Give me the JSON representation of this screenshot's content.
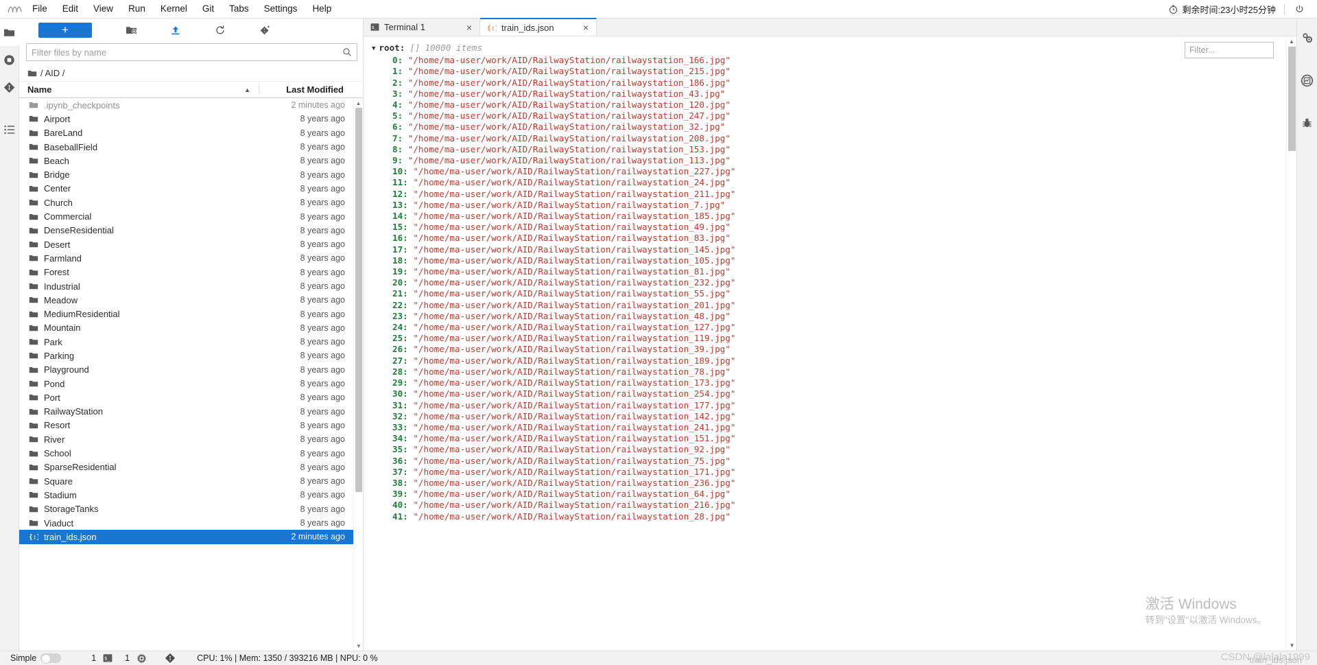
{
  "menubar": {
    "logo_name": "jupyter-logo",
    "items": [
      "File",
      "Edit",
      "View",
      "Run",
      "Kernel",
      "Git",
      "Tabs",
      "Settings",
      "Help"
    ],
    "timer_text": "剩余时间:23小时25分钟",
    "power_label": "power-icon"
  },
  "left_activity": [
    {
      "name": "sidebar-item-file-browser",
      "icon": "folder-icon"
    },
    {
      "name": "sidebar-item-running-sessions",
      "icon": "stop-circle-icon"
    },
    {
      "name": "sidebar-item-git",
      "icon": "git-icon"
    },
    {
      "name": "sidebar-item-table-of-contents",
      "icon": "list-icon"
    }
  ],
  "right_activity": [
    {
      "name": "sidebar-item-property-inspector",
      "icon": "gears-icon"
    },
    {
      "name": "sidebar-item-extension-manager",
      "icon": "chart-circle-icon"
    },
    {
      "name": "sidebar-item-debugger",
      "icon": "bug-icon"
    }
  ],
  "filebrowser": {
    "toolbar": {
      "new_launcher_label": "+",
      "new_folder_label": "new-folder-icon",
      "upload_label": "upload-icon",
      "refresh_label": "refresh-icon",
      "git_clone_label": "git-clone-icon"
    },
    "filter_placeholder": "Filter files by name",
    "filter_value": "",
    "breadcrumb": "/ AID /",
    "columns": {
      "name": "Name",
      "last_modified": "Last Modified"
    },
    "rows": [
      {
        "name": ".ipynb_checkpoints",
        "modified": "2 minutes ago",
        "type": "folder",
        "dim": true,
        "selected": false
      },
      {
        "name": "Airport",
        "modified": "8 years ago",
        "type": "folder",
        "dim": false,
        "selected": false
      },
      {
        "name": "BareLand",
        "modified": "8 years ago",
        "type": "folder",
        "dim": false,
        "selected": false
      },
      {
        "name": "BaseballField",
        "modified": "8 years ago",
        "type": "folder",
        "dim": false,
        "selected": false
      },
      {
        "name": "Beach",
        "modified": "8 years ago",
        "type": "folder",
        "dim": false,
        "selected": false
      },
      {
        "name": "Bridge",
        "modified": "8 years ago",
        "type": "folder",
        "dim": false,
        "selected": false
      },
      {
        "name": "Center",
        "modified": "8 years ago",
        "type": "folder",
        "dim": false,
        "selected": false
      },
      {
        "name": "Church",
        "modified": "8 years ago",
        "type": "folder",
        "dim": false,
        "selected": false
      },
      {
        "name": "Commercial",
        "modified": "8 years ago",
        "type": "folder",
        "dim": false,
        "selected": false
      },
      {
        "name": "DenseResidential",
        "modified": "8 years ago",
        "type": "folder",
        "dim": false,
        "selected": false
      },
      {
        "name": "Desert",
        "modified": "8 years ago",
        "type": "folder",
        "dim": false,
        "selected": false
      },
      {
        "name": "Farmland",
        "modified": "8 years ago",
        "type": "folder",
        "dim": false,
        "selected": false
      },
      {
        "name": "Forest",
        "modified": "8 years ago",
        "type": "folder",
        "dim": false,
        "selected": false
      },
      {
        "name": "Industrial",
        "modified": "8 years ago",
        "type": "folder",
        "dim": false,
        "selected": false
      },
      {
        "name": "Meadow",
        "modified": "8 years ago",
        "type": "folder",
        "dim": false,
        "selected": false
      },
      {
        "name": "MediumResidential",
        "modified": "8 years ago",
        "type": "folder",
        "dim": false,
        "selected": false
      },
      {
        "name": "Mountain",
        "modified": "8 years ago",
        "type": "folder",
        "dim": false,
        "selected": false
      },
      {
        "name": "Park",
        "modified": "8 years ago",
        "type": "folder",
        "dim": false,
        "selected": false
      },
      {
        "name": "Parking",
        "modified": "8 years ago",
        "type": "folder",
        "dim": false,
        "selected": false
      },
      {
        "name": "Playground",
        "modified": "8 years ago",
        "type": "folder",
        "dim": false,
        "selected": false
      },
      {
        "name": "Pond",
        "modified": "8 years ago",
        "type": "folder",
        "dim": false,
        "selected": false
      },
      {
        "name": "Port",
        "modified": "8 years ago",
        "type": "folder",
        "dim": false,
        "selected": false
      },
      {
        "name": "RailwayStation",
        "modified": "8 years ago",
        "type": "folder",
        "dim": false,
        "selected": false
      },
      {
        "name": "Resort",
        "modified": "8 years ago",
        "type": "folder",
        "dim": false,
        "selected": false
      },
      {
        "name": "River",
        "modified": "8 years ago",
        "type": "folder",
        "dim": false,
        "selected": false
      },
      {
        "name": "School",
        "modified": "8 years ago",
        "type": "folder",
        "dim": false,
        "selected": false
      },
      {
        "name": "SparseResidential",
        "modified": "8 years ago",
        "type": "folder",
        "dim": false,
        "selected": false
      },
      {
        "name": "Square",
        "modified": "8 years ago",
        "type": "folder",
        "dim": false,
        "selected": false
      },
      {
        "name": "Stadium",
        "modified": "8 years ago",
        "type": "folder",
        "dim": false,
        "selected": false
      },
      {
        "name": "StorageTanks",
        "modified": "8 years ago",
        "type": "folder",
        "dim": false,
        "selected": false
      },
      {
        "name": "Viaduct",
        "modified": "8 years ago",
        "type": "folder",
        "dim": false,
        "selected": false
      },
      {
        "name": "train_ids.json",
        "modified": "2 minutes ago",
        "type": "json",
        "dim": false,
        "selected": true
      }
    ]
  },
  "dock": {
    "tabs": [
      {
        "label": "Terminal 1",
        "icon": "terminal-icon",
        "active": false,
        "close": "×"
      },
      {
        "label": "train_ids.json",
        "icon": "json-icon",
        "active": true,
        "close": "×"
      }
    ]
  },
  "json_viewer": {
    "filter_placeholder": "Filter...",
    "filter_value": "",
    "root_label": "root:",
    "root_type": "[]",
    "root_count": "10000 items",
    "items": [
      {
        "index": "0:",
        "value": "\"/home/ma-user/work/AID/RailwayStation/railwaystation_166.jpg\""
      },
      {
        "index": "1:",
        "value": "\"/home/ma-user/work/AID/RailwayStation/railwaystation_215.jpg\""
      },
      {
        "index": "2:",
        "value": "\"/home/ma-user/work/AID/RailwayStation/railwaystation_186.jpg\""
      },
      {
        "index": "3:",
        "value": "\"/home/ma-user/work/AID/RailwayStation/railwaystation_43.jpg\""
      },
      {
        "index": "4:",
        "value": "\"/home/ma-user/work/AID/RailwayStation/railwaystation_120.jpg\""
      },
      {
        "index": "5:",
        "value": "\"/home/ma-user/work/AID/RailwayStation/railwaystation_247.jpg\""
      },
      {
        "index": "6:",
        "value": "\"/home/ma-user/work/AID/RailwayStation/railwaystation_32.jpg\""
      },
      {
        "index": "7:",
        "value": "\"/home/ma-user/work/AID/RailwayStation/railwaystation_208.jpg\""
      },
      {
        "index": "8:",
        "value": "\"/home/ma-user/work/AID/RailwayStation/railwaystation_153.jpg\""
      },
      {
        "index": "9:",
        "value": "\"/home/ma-user/work/AID/RailwayStation/railwaystation_113.jpg\""
      },
      {
        "index": "10:",
        "value": "\"/home/ma-user/work/AID/RailwayStation/railwaystation_227.jpg\""
      },
      {
        "index": "11:",
        "value": "\"/home/ma-user/work/AID/RailwayStation/railwaystation_24.jpg\""
      },
      {
        "index": "12:",
        "value": "\"/home/ma-user/work/AID/RailwayStation/railwaystation_211.jpg\""
      },
      {
        "index": "13:",
        "value": "\"/home/ma-user/work/AID/RailwayStation/railwaystation_7.jpg\""
      },
      {
        "index": "14:",
        "value": "\"/home/ma-user/work/AID/RailwayStation/railwaystation_185.jpg\""
      },
      {
        "index": "15:",
        "value": "\"/home/ma-user/work/AID/RailwayStation/railwaystation_49.jpg\""
      },
      {
        "index": "16:",
        "value": "\"/home/ma-user/work/AID/RailwayStation/railwaystation_83.jpg\""
      },
      {
        "index": "17:",
        "value": "\"/home/ma-user/work/AID/RailwayStation/railwaystation_145.jpg\""
      },
      {
        "index": "18:",
        "value": "\"/home/ma-user/work/AID/RailwayStation/railwaystation_105.jpg\""
      },
      {
        "index": "19:",
        "value": "\"/home/ma-user/work/AID/RailwayStation/railwaystation_81.jpg\""
      },
      {
        "index": "20:",
        "value": "\"/home/ma-user/work/AID/RailwayStation/railwaystation_232.jpg\""
      },
      {
        "index": "21:",
        "value": "\"/home/ma-user/work/AID/RailwayStation/railwaystation_55.jpg\""
      },
      {
        "index": "22:",
        "value": "\"/home/ma-user/work/AID/RailwayStation/railwaystation_201.jpg\""
      },
      {
        "index": "23:",
        "value": "\"/home/ma-user/work/AID/RailwayStation/railwaystation_48.jpg\""
      },
      {
        "index": "24:",
        "value": "\"/home/ma-user/work/AID/RailwayStation/railwaystation_127.jpg\""
      },
      {
        "index": "25:",
        "value": "\"/home/ma-user/work/AID/RailwayStation/railwaystation_119.jpg\""
      },
      {
        "index": "26:",
        "value": "\"/home/ma-user/work/AID/RailwayStation/railwaystation_39.jpg\""
      },
      {
        "index": "27:",
        "value": "\"/home/ma-user/work/AID/RailwayStation/railwaystation_189.jpg\""
      },
      {
        "index": "28:",
        "value": "\"/home/ma-user/work/AID/RailwayStation/railwaystation_78.jpg\""
      },
      {
        "index": "29:",
        "value": "\"/home/ma-user/work/AID/RailwayStation/railwaystation_173.jpg\""
      },
      {
        "index": "30:",
        "value": "\"/home/ma-user/work/AID/RailwayStation/railwaystation_254.jpg\""
      },
      {
        "index": "31:",
        "value": "\"/home/ma-user/work/AID/RailwayStation/railwaystation_177.jpg\""
      },
      {
        "index": "32:",
        "value": "\"/home/ma-user/work/AID/RailwayStation/railwaystation_142.jpg\""
      },
      {
        "index": "33:",
        "value": "\"/home/ma-user/work/AID/RailwayStation/railwaystation_241.jpg\""
      },
      {
        "index": "34:",
        "value": "\"/home/ma-user/work/AID/RailwayStation/railwaystation_151.jpg\""
      },
      {
        "index": "35:",
        "value": "\"/home/ma-user/work/AID/RailwayStation/railwaystation_92.jpg\""
      },
      {
        "index": "36:",
        "value": "\"/home/ma-user/work/AID/RailwayStation/railwaystation_75.jpg\""
      },
      {
        "index": "37:",
        "value": "\"/home/ma-user/work/AID/RailwayStation/railwaystation_171.jpg\""
      },
      {
        "index": "38:",
        "value": "\"/home/ma-user/work/AID/RailwayStation/railwaystation_236.jpg\""
      },
      {
        "index": "39:",
        "value": "\"/home/ma-user/work/AID/RailwayStation/railwaystation_64.jpg\""
      },
      {
        "index": "40:",
        "value": "\"/home/ma-user/work/AID/RailwayStation/railwaystation_216.jpg\""
      },
      {
        "index": "41:",
        "value": "\"/home/ma-user/work/AID/RailwayStation/railwaystation_28.jpg\""
      }
    ]
  },
  "statusbar": {
    "mode_label": "Simple",
    "terminal_count": "1",
    "kernel_count": "1",
    "resources": "CPU: 1% | Mem: 1350 / 393216 MB | NPU: 0 %"
  },
  "watermarks": {
    "windows_title": "激活 Windows",
    "windows_sub": "转到\"设置\"以激活 Windows。",
    "csdn": "CSDN @lalala1999",
    "csdn_overlap": "train_ids.json"
  },
  "colors": {
    "accent": "#1976d2",
    "json_key": "#1a7f37",
    "json_value": "#c0392b",
    "selected_row": "#1976d2"
  }
}
